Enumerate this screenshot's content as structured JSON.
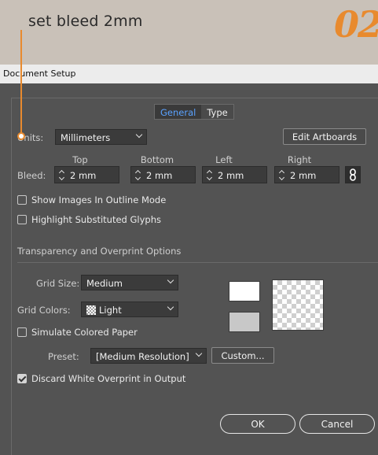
{
  "annotation": {
    "caption": "set bleed 2mm",
    "number": "02"
  },
  "dialog": {
    "title": "Document Setup",
    "tabs": [
      {
        "label": "General",
        "active": true
      },
      {
        "label": "Type",
        "active": false
      }
    ],
    "units": {
      "label": "Units:",
      "value": "Millimeters"
    },
    "edit_artboards_label": "Edit Artboards",
    "bleed": {
      "label": "Bleed:",
      "columns": [
        "Top",
        "Bottom",
        "Left",
        "Right"
      ],
      "values": [
        "2 mm",
        "2 mm",
        "2 mm",
        "2 mm"
      ],
      "link_glyph": "∅"
    },
    "checkboxes": {
      "show_images": {
        "label": "Show Images In Outline Mode",
        "checked": false
      },
      "highlight_glyphs": {
        "label": "Highlight Substituted Glyphs",
        "checked": false
      }
    },
    "transparency": {
      "section_label": "Transparency and Overprint Options",
      "grid_size": {
        "label": "Grid Size:",
        "value": "Medium"
      },
      "grid_colors": {
        "label": "Grid Colors:",
        "value": "Light"
      },
      "simulate_paper": {
        "label": "Simulate Colored Paper",
        "checked": false
      },
      "preset": {
        "label": "Preset:",
        "value": "[Medium Resolution]"
      },
      "custom_label": "Custom...",
      "discard_overprint": {
        "label": "Discard White Overprint in Output",
        "checked": true
      }
    },
    "ok_label": "OK",
    "cancel_label": "Cancel"
  },
  "colors": {
    "accent_orange": "#e88a2e",
    "dialog_bg": "#535353",
    "tab_active": "#5aa2ff",
    "page_bg": "#c9c1b8"
  }
}
